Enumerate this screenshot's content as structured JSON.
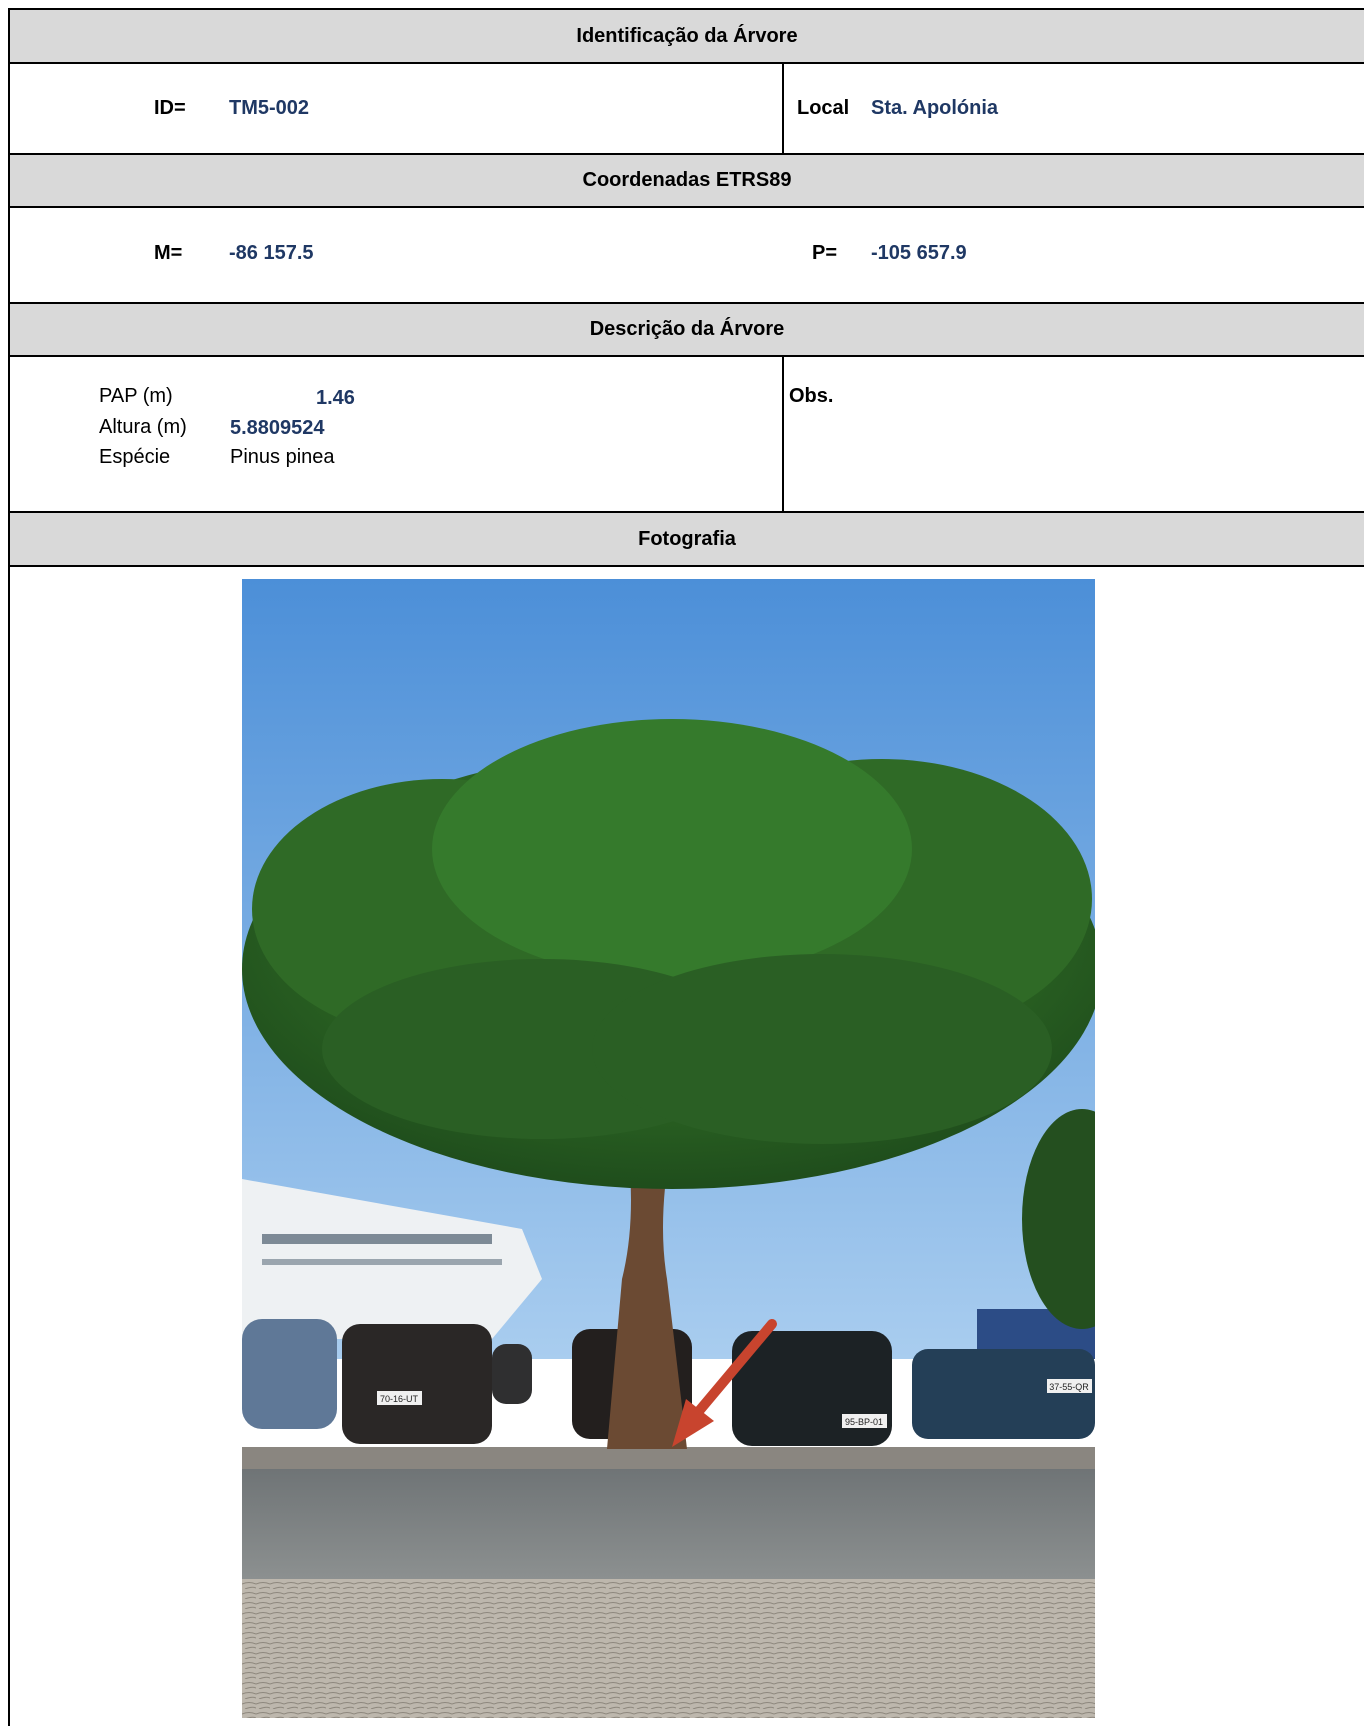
{
  "sections": {
    "identification_title": "Identificação da Árvore",
    "coordinates_title": "Coordenadas ETRS89",
    "description_title": "Descrição da Árvore",
    "photo_title": "Fotografia"
  },
  "identification": {
    "id_label": "ID=",
    "id_value": "TM5-002",
    "local_label": "Local",
    "local_value": "Sta. Apolónia"
  },
  "coordinates": {
    "m_label": "M=",
    "m_value": "-86 157.5",
    "p_label": "P=",
    "p_value": "-105 657.9"
  },
  "description": {
    "pap_label": "PAP (m)",
    "pap_value": "1.46",
    "height_label": "Altura (m)",
    "height_value": "5.8809524",
    "species_label": "Espécie",
    "species_value": "Pinus pinea",
    "obs_label": "Obs."
  },
  "photo": {
    "plate_left": "70-16-UT",
    "plate_center": "95-BP-01",
    "plate_right": "37-55-QR",
    "colors": {
      "sky_top": "#4c8fd8",
      "sky_bottom": "#9fc7ee",
      "canopy": "#2f6a26",
      "trunk": "#6b4a33",
      "arrow": "#c8442e"
    }
  }
}
